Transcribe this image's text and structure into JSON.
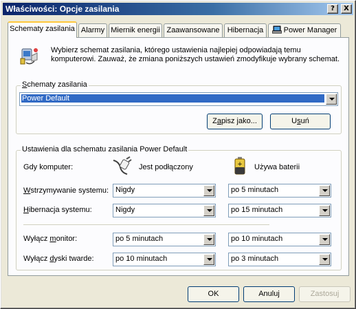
{
  "title": "Właściwości: Opcje zasilania",
  "titlebar_buttons": [
    "?",
    "X"
  ],
  "tabs": [
    {
      "label": "Schematy zasilania",
      "active": true
    },
    {
      "label": "Alarmy"
    },
    {
      "label": "Miernik energii"
    },
    {
      "label": "Zaawansowane"
    },
    {
      "label": "Hibernacja"
    },
    {
      "label": "Power Manager",
      "icon": "laptop-icon"
    }
  ],
  "intro": {
    "icon": "power-options-icon",
    "text": "Wybierz schemat zasilania, którego ustawienia najlepiej odpowiadają temu komputerowi. Zauważ, że zmiana poniższych ustawień zmodyfikuje wybrany schemat."
  },
  "schemes": {
    "group_label_u": "S",
    "group_label_rest": "chematy zasilania",
    "selected": "Power Default",
    "save_as_pre": "Z",
    "save_as_u": "a",
    "save_as_rest": "pisz jako...",
    "delete_pre": "U",
    "delete_u": "s",
    "delete_rest": "uń"
  },
  "settings": {
    "group_label": "Ustawienia dla schematu zasilania Power Default",
    "computer_label": "Gdy komputer:",
    "plugged_in": "Jest podłączony",
    "plugged_icon": "plug-icon",
    "on_battery": "Używa baterii",
    "battery_icon": "battery-icon",
    "rows": [
      {
        "label_u": "W",
        "label_rest": "strzymywanie systemu:",
        "ac": "Nigdy",
        "dc": "po 5 minutach"
      },
      {
        "label_u": "H",
        "label_rest": "ibernacja systemu:",
        "ac": "Nigdy",
        "dc": "po 15 minutach"
      },
      {
        "label_pre": "Wyłącz ",
        "label_u": "m",
        "label_rest": "onitor:",
        "ac": "po 5 minutach",
        "dc": "po 10 minutach"
      },
      {
        "label_pre": "Wyłącz ",
        "label_u": "d",
        "label_rest": "yski twarde:",
        "ac": "po 10 minutach",
        "dc": "po 3 minutach"
      }
    ]
  },
  "footer": {
    "ok": "OK",
    "cancel": "Anuluj",
    "apply": "Zastosuj"
  }
}
